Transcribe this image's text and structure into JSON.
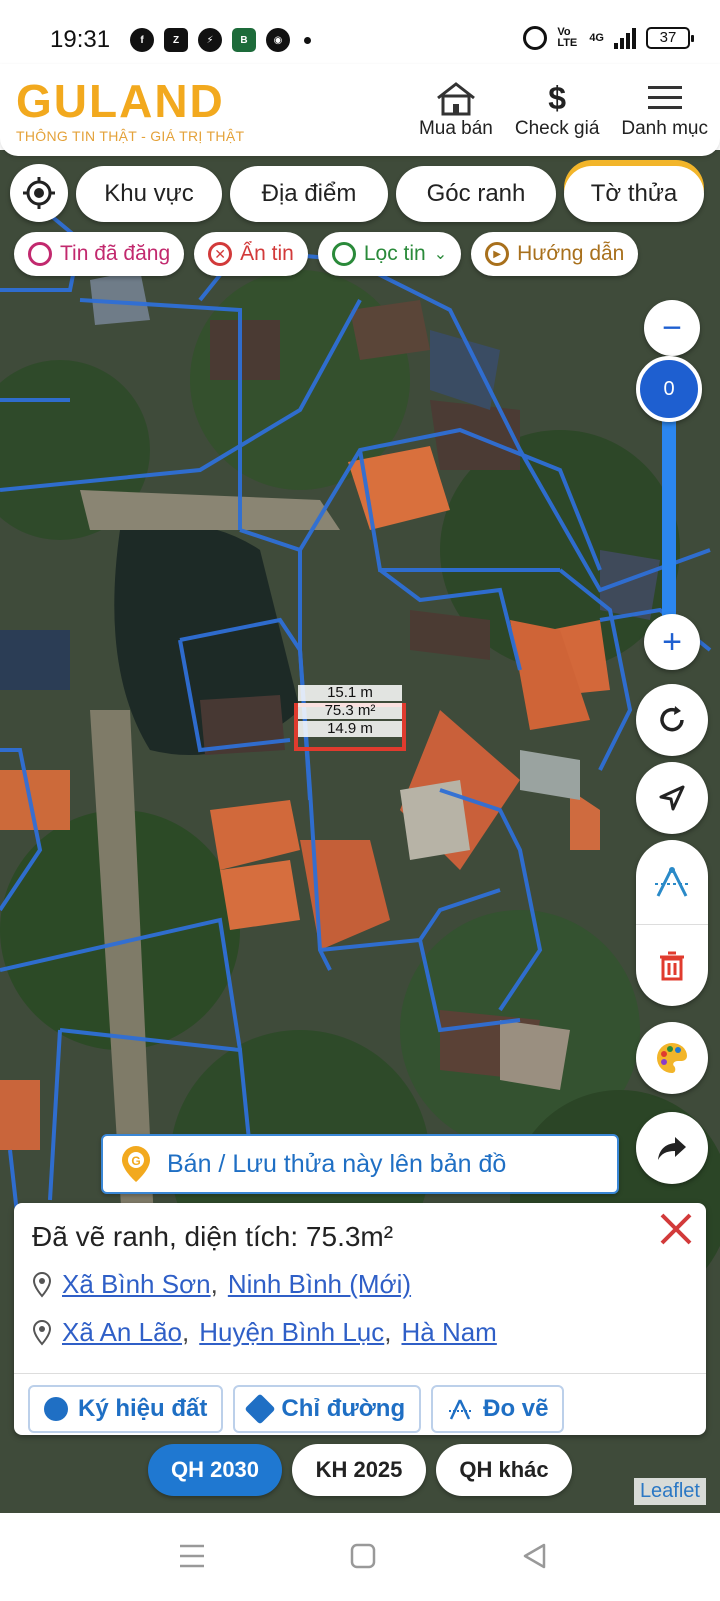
{
  "status_bar": {
    "time": "19:31",
    "battery": "37",
    "network": "4G",
    "volte": "Vo LTE",
    "app_icons": [
      "facebook-icon",
      "zalo-icon",
      "messenger-icon",
      "bidv-icon",
      "basketball-icon"
    ]
  },
  "header": {
    "logo_text": "GULAND",
    "tagline": "THÔNG TIN THẬT - GIÁ TRỊ THẬT",
    "nav": [
      {
        "label": "Mua bán",
        "icon": "house-icon"
      },
      {
        "label": "Check giá",
        "icon": "dollar-icon"
      },
      {
        "label": "Danh mục",
        "icon": "menu-icon"
      }
    ]
  },
  "filters": {
    "primary": [
      "Khu vực",
      "Địa điểm",
      "Góc ranh",
      "Tờ thửa"
    ],
    "secondary": [
      "Tin đã đăng",
      "Ẩn tin",
      "Lọc tin",
      "Hướng dẫn"
    ]
  },
  "zoom": {
    "level": "0"
  },
  "measurement": {
    "top_edge": "15.1 m",
    "area": "75.3 m²",
    "bottom_edge": "14.9 m"
  },
  "save_banner": {
    "label": "Bán / Lưu thửa này lên bản đồ"
  },
  "info_panel": {
    "title": "Đã vẽ ranh, diện tích: 75.3m²",
    "new_location": {
      "commune": "Xã Bình Sơn",
      "province": "Ninh Bình (Mới)"
    },
    "old_location": {
      "commune": "Xã An Lão",
      "district": "Huyện Bình Lục",
      "province": "Hà Nam"
    },
    "actions": [
      "Ký hiệu đất",
      "Chỉ đường",
      "Đo vẽ"
    ]
  },
  "plan_tabs": {
    "items": [
      "QH 2030",
      "KH 2025",
      "QH khác"
    ],
    "active": "QH 2030"
  },
  "attribution": "Leaflet",
  "colors": {
    "brand": "#f2a91e",
    "accent_blue": "#1f78d1",
    "parcel_line": "#2f6fd6",
    "measure_red": "#e03b2e"
  }
}
